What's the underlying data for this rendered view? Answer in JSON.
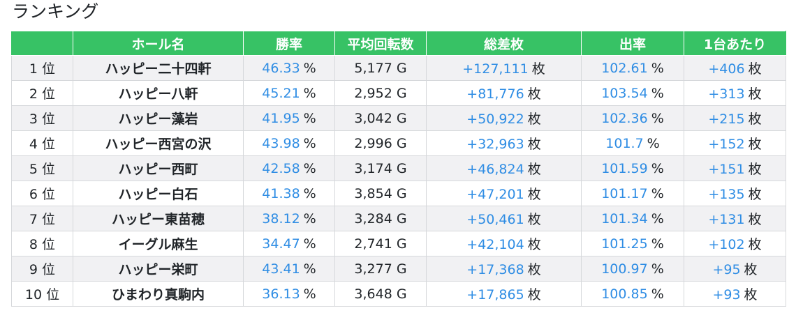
{
  "title": "ランキング",
  "columns": [
    "",
    "ホール名",
    "勝率",
    "平均回転数",
    "総差枚",
    "出率",
    "1台あたり"
  ],
  "rows": [
    {
      "rank": "1 位",
      "hall": "ハッピー二十四軒",
      "win_rate": "46.33",
      "win_rate_unit": "%",
      "avg_spins": "5,177 G",
      "total_diff": "+127,111",
      "total_diff_unit": "枚",
      "payout": "102.61",
      "payout_unit": "%",
      "per_machine": "+406",
      "per_machine_unit": "枚"
    },
    {
      "rank": "2 位",
      "hall": "ハッピー八軒",
      "win_rate": "45.21",
      "win_rate_unit": "%",
      "avg_spins": "2,952 G",
      "total_diff": "+81,776",
      "total_diff_unit": "枚",
      "payout": "103.54",
      "payout_unit": "%",
      "per_machine": "+313",
      "per_machine_unit": "枚"
    },
    {
      "rank": "3 位",
      "hall": "ハッピー藻岩",
      "win_rate": "41.95",
      "win_rate_unit": "%",
      "avg_spins": "3,042 G",
      "total_diff": "+50,922",
      "total_diff_unit": "枚",
      "payout": "102.36",
      "payout_unit": "%",
      "per_machine": "+215",
      "per_machine_unit": "枚"
    },
    {
      "rank": "4 位",
      "hall": "ハッピー西宮の沢",
      "win_rate": "43.98",
      "win_rate_unit": "%",
      "avg_spins": "2,996 G",
      "total_diff": "+32,963",
      "total_diff_unit": "枚",
      "payout": "101.7",
      "payout_unit": "%",
      "per_machine": "+152",
      "per_machine_unit": "枚"
    },
    {
      "rank": "5 位",
      "hall": "ハッピー西町",
      "win_rate": "42.58",
      "win_rate_unit": "%",
      "avg_spins": "3,174 G",
      "total_diff": "+46,824",
      "total_diff_unit": "枚",
      "payout": "101.59",
      "payout_unit": "%",
      "per_machine": "+151",
      "per_machine_unit": "枚"
    },
    {
      "rank": "6 位",
      "hall": "ハッピー白石",
      "win_rate": "41.38",
      "win_rate_unit": "%",
      "avg_spins": "3,854 G",
      "total_diff": "+47,201",
      "total_diff_unit": "枚",
      "payout": "101.17",
      "payout_unit": "%",
      "per_machine": "+135",
      "per_machine_unit": "枚"
    },
    {
      "rank": "7 位",
      "hall": "ハッピー東苗穂",
      "win_rate": "38.12",
      "win_rate_unit": "%",
      "avg_spins": "3,284 G",
      "total_diff": "+50,461",
      "total_diff_unit": "枚",
      "payout": "101.34",
      "payout_unit": "%",
      "per_machine": "+131",
      "per_machine_unit": "枚"
    },
    {
      "rank": "8 位",
      "hall": "イーグル麻生",
      "win_rate": "34.47",
      "win_rate_unit": "%",
      "avg_spins": "2,741 G",
      "total_diff": "+42,104",
      "total_diff_unit": "枚",
      "payout": "101.25",
      "payout_unit": "%",
      "per_machine": "+102",
      "per_machine_unit": "枚"
    },
    {
      "rank": "9 位",
      "hall": "ハッピー栄町",
      "win_rate": "43.41",
      "win_rate_unit": "%",
      "avg_spins": "3,277 G",
      "total_diff": "+17,368",
      "total_diff_unit": "枚",
      "payout": "100.97",
      "payout_unit": "%",
      "per_machine": "+95",
      "per_machine_unit": "枚"
    },
    {
      "rank": "10 位",
      "hall": "ひまわり真駒内",
      "win_rate": "36.13",
      "win_rate_unit": "%",
      "avg_spins": "3,648 G",
      "total_diff": "+17,865",
      "total_diff_unit": "枚",
      "payout": "100.85",
      "payout_unit": "%",
      "per_machine": "+93",
      "per_machine_unit": "枚"
    }
  ],
  "colors": {
    "header_bg": "#37c265",
    "header_text": "#ffffff",
    "value_blue": "#2f8de4",
    "row_stripe": "#f1f1f3",
    "border": "#d6d8db"
  }
}
